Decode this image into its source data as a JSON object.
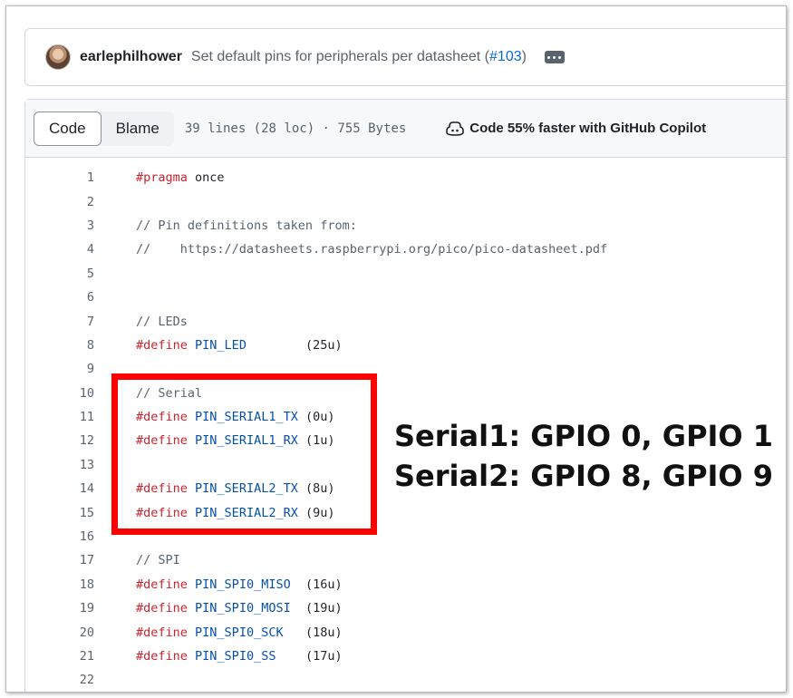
{
  "commit": {
    "author": "earlephilhower",
    "message_prefix": "Set default pins for peripherals per datasheet (",
    "pr_link": "#103",
    "message_suffix": ")"
  },
  "file_header": {
    "tabs": [
      {
        "label": "Code",
        "active": true
      },
      {
        "label": "Blame",
        "active": false
      }
    ],
    "file_info": "39 lines (28 loc) · 755 Bytes",
    "copilot_text": "Code 55% faster with GitHub Copilot"
  },
  "code_lines": [
    {
      "n": "1",
      "kw": "#pragma",
      "ident": "",
      "rest": " once",
      "comment": ""
    },
    {
      "n": "2",
      "kw": "",
      "ident": "",
      "rest": "",
      "comment": ""
    },
    {
      "n": "3",
      "kw": "",
      "ident": "",
      "rest": "",
      "comment": "// Pin definitions taken from:"
    },
    {
      "n": "4",
      "kw": "",
      "ident": "",
      "rest": "",
      "comment": "//    https://datasheets.raspberrypi.org/pico/pico-datasheet.pdf"
    },
    {
      "n": "5",
      "kw": "",
      "ident": "",
      "rest": "",
      "comment": ""
    },
    {
      "n": "6",
      "kw": "",
      "ident": "",
      "rest": "",
      "comment": ""
    },
    {
      "n": "7",
      "kw": "",
      "ident": "",
      "rest": "",
      "comment": "// LEDs"
    },
    {
      "n": "8",
      "kw": "#define",
      "ident": "PIN_LED",
      "rest": "        (25u)",
      "comment": ""
    },
    {
      "n": "9",
      "kw": "",
      "ident": "",
      "rest": "",
      "comment": ""
    },
    {
      "n": "10",
      "kw": "",
      "ident": "",
      "rest": "",
      "comment": "// Serial"
    },
    {
      "n": "11",
      "kw": "#define",
      "ident": "PIN_SERIAL1_TX",
      "rest": " (0u)",
      "comment": ""
    },
    {
      "n": "12",
      "kw": "#define",
      "ident": "PIN_SERIAL1_RX",
      "rest": " (1u)",
      "comment": ""
    },
    {
      "n": "13",
      "kw": "",
      "ident": "",
      "rest": "",
      "comment": ""
    },
    {
      "n": "14",
      "kw": "#define",
      "ident": "PIN_SERIAL2_TX",
      "rest": " (8u)",
      "comment": ""
    },
    {
      "n": "15",
      "kw": "#define",
      "ident": "PIN_SERIAL2_RX",
      "rest": " (9u)",
      "comment": ""
    },
    {
      "n": "16",
      "kw": "",
      "ident": "",
      "rest": "",
      "comment": ""
    },
    {
      "n": "17",
      "kw": "",
      "ident": "",
      "rest": "",
      "comment": "// SPI"
    },
    {
      "n": "18",
      "kw": "#define",
      "ident": "PIN_SPI0_MISO",
      "rest": "  (16u)",
      "comment": ""
    },
    {
      "n": "19",
      "kw": "#define",
      "ident": "PIN_SPI0_MOSI",
      "rest": "  (19u)",
      "comment": ""
    },
    {
      "n": "20",
      "kw": "#define",
      "ident": "PIN_SPI0_SCK",
      "rest": "   (18u)",
      "comment": ""
    },
    {
      "n": "21",
      "kw": "#define",
      "ident": "PIN_SPI0_SS",
      "rest": "    (17u)",
      "comment": ""
    },
    {
      "n": "22",
      "kw": "",
      "ident": "",
      "rest": "",
      "comment": ""
    }
  ],
  "annotation": {
    "line1": "Serial1: GPIO 0, GPIO 1",
    "line2": "Serial2: GPIO 8, GPIO 9"
  },
  "colors": {
    "keyword": "#cf222e",
    "identifier": "#0550ae",
    "highlight_box": "#ff0000",
    "link": "#0969da"
  }
}
